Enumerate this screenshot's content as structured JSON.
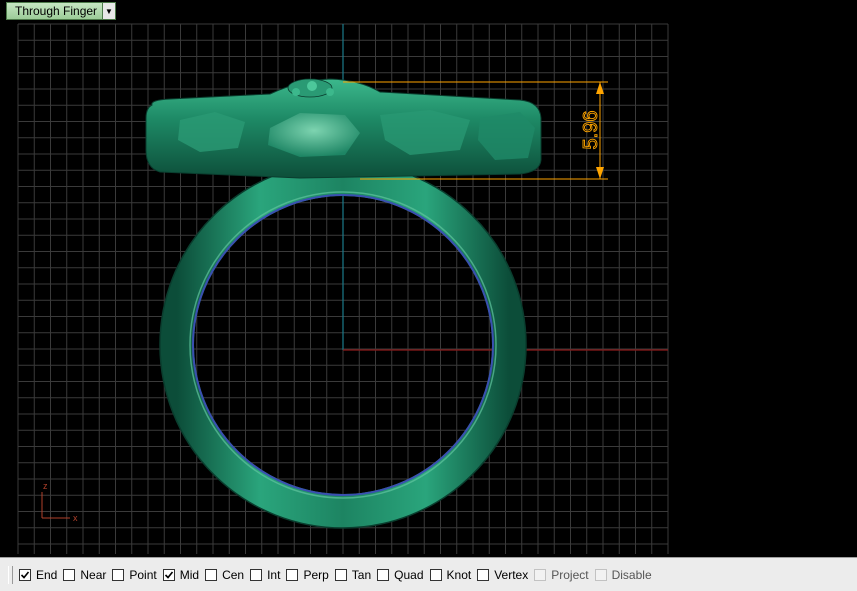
{
  "viewport": {
    "title": "Through Finger",
    "dimension_value": "5.96",
    "axis_labels": {
      "x": "x",
      "z": "z"
    }
  },
  "osnap": [
    {
      "label": "End",
      "checked": true,
      "enabled": true
    },
    {
      "label": "Near",
      "checked": false,
      "enabled": true
    },
    {
      "label": "Point",
      "checked": false,
      "enabled": true
    },
    {
      "label": "Mid",
      "checked": true,
      "enabled": true
    },
    {
      "label": "Cen",
      "checked": false,
      "enabled": true
    },
    {
      "label": "Int",
      "checked": false,
      "enabled": true
    },
    {
      "label": "Perp",
      "checked": false,
      "enabled": true
    },
    {
      "label": "Tan",
      "checked": false,
      "enabled": true
    },
    {
      "label": "Quad",
      "checked": false,
      "enabled": true
    },
    {
      "label": "Knot",
      "checked": false,
      "enabled": true
    },
    {
      "label": "Vertex",
      "checked": false,
      "enabled": true
    },
    {
      "label": "Project",
      "checked": false,
      "enabled": false
    },
    {
      "label": "Disable",
      "checked": false,
      "enabled": false
    }
  ],
  "colors": {
    "grid": "#3a3a3a",
    "ring": "#1f8a68",
    "ring_highlight": "#7fd6b0",
    "dimension": "#ffa500",
    "x_axis": "#8b1a1a",
    "z_axis": "#1a7a8a"
  }
}
